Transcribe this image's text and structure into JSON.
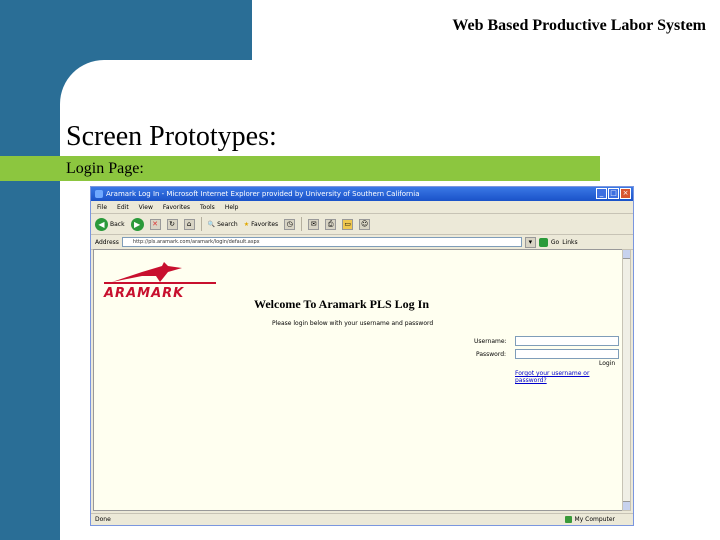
{
  "slide": {
    "header": "Web Based Productive Labor System",
    "title": "Screen Prototypes:",
    "subtitle": "Login Page:"
  },
  "browser": {
    "title": "Aramark Log In - Microsoft Internet Explorer provided by University of Southern California",
    "menu": [
      "File",
      "Edit",
      "View",
      "Favorites",
      "Tools",
      "Help"
    ],
    "toolbar": {
      "back": "Back",
      "search": "Search",
      "favorites": "Favorites"
    },
    "address_label": "Address",
    "address_value": "http://pls.aramark.com/aramark/login/default.aspx",
    "go_label": "Go",
    "links_label": "Links",
    "status_left": "Done",
    "status_zone": "My Computer"
  },
  "page": {
    "logo_text": "ARAMARK",
    "welcome": "Welcome To Aramark PLS Log In",
    "instruction": "Please login below with your username and password",
    "username_label": "Username:",
    "password_label": "Password:",
    "login_button": "Login",
    "forgot_link": "Forgot your username or password?"
  },
  "colors": {
    "slide_blue": "#2a6e96",
    "slide_green": "#8cc63f",
    "brand_red": "#c8102e"
  }
}
